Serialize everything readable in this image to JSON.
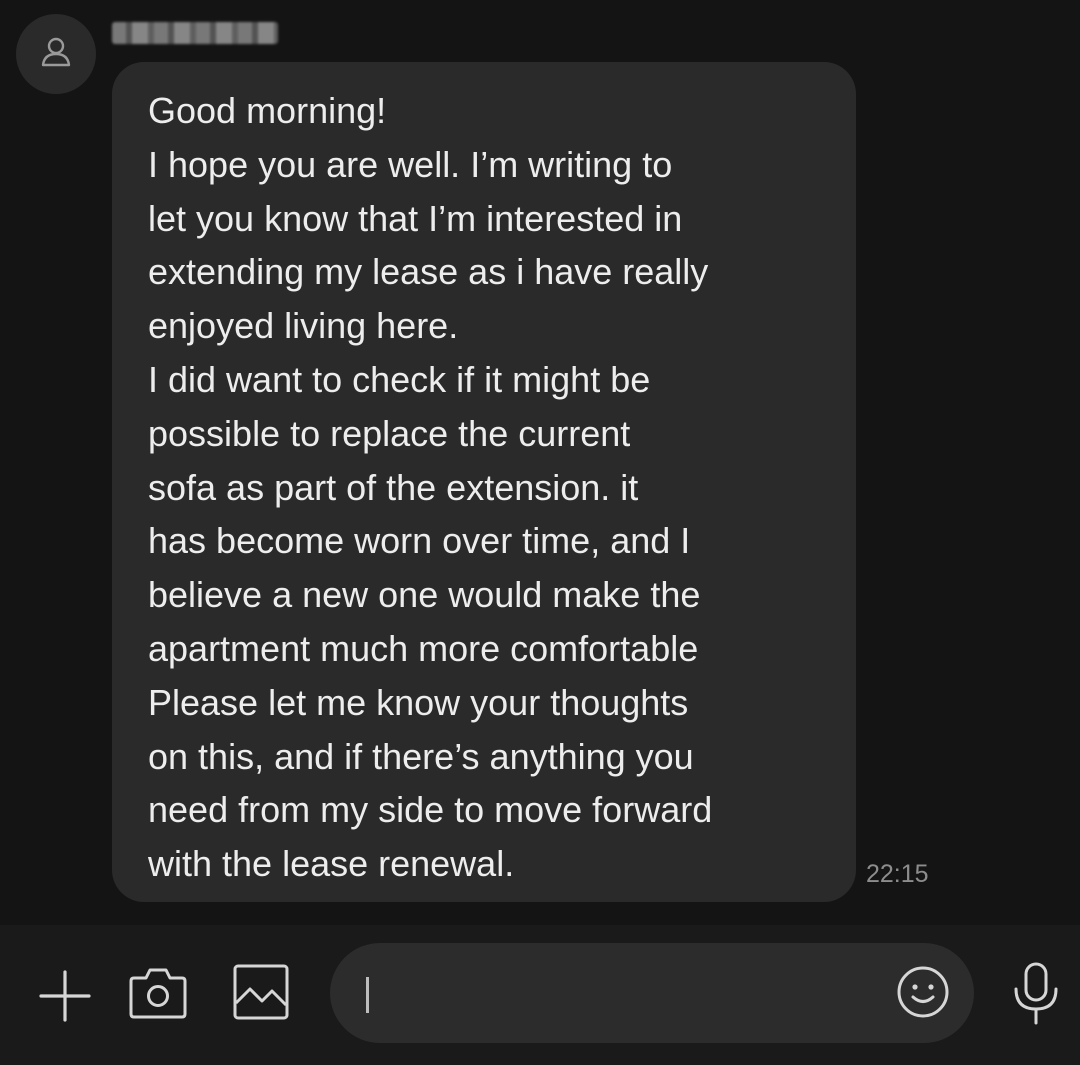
{
  "conversation": {
    "sender": {
      "avatar_icon": "person-icon"
    },
    "message": {
      "lines": [
        "Good morning!",
        "I hope you are well. I’m writing to",
        "let you know that I’m interested in",
        "extending my lease as i have really",
        "enjoyed living here.",
        "I did want to check if it might be",
        "possible to replace the current",
        "sofa as part of the extension. it",
        "has become worn over time, and I",
        "believe a new one would make the",
        "apartment much more comfortable",
        "Please let me know your thoughts",
        "on this, and if there’s anything you",
        "need from my side to move forward",
        "with the lease renewal."
      ],
      "time": "22:15"
    }
  },
  "composer": {
    "input_value": "",
    "icons": {
      "add": "plus-icon",
      "camera": "camera-icon",
      "gallery": "image-icon",
      "emoji": "smiley-icon",
      "voice": "microphone-icon"
    }
  },
  "colors": {
    "background": "#141414",
    "bubble": "#2a2a2a",
    "text": "#ededed",
    "timestamp": "#8d8d8d",
    "input_bar": "#1a1a1a",
    "input_field": "#2c2c2c",
    "icon": "#d6d6d6"
  }
}
